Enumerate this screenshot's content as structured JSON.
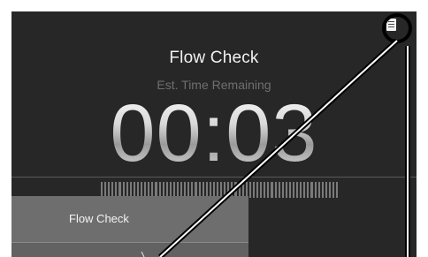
{
  "screen": {
    "title": "Flow Check",
    "subtitle": "Est. Time Remaining",
    "timer": "00:03",
    "panel_label": "Flow Check"
  },
  "icons": {
    "menu": "list-icon"
  },
  "colors": {
    "screen_bg": "#272727",
    "panel_bg": "#6e6e6e",
    "callout": "#000000"
  }
}
